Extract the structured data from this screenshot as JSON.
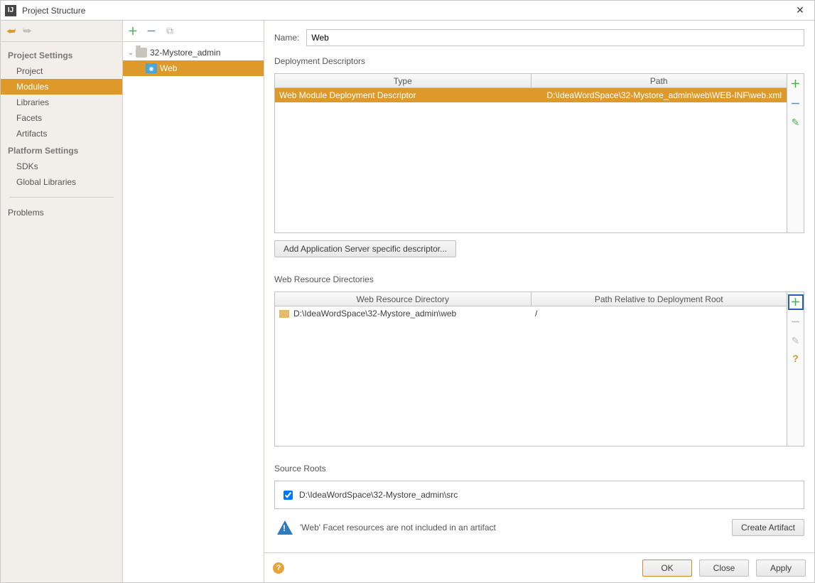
{
  "window": {
    "title": "Project Structure"
  },
  "sidebar": {
    "sections": [
      {
        "header": "Project Settings",
        "items": [
          "Project",
          "Modules",
          "Libraries",
          "Facets",
          "Artifacts"
        ],
        "selected": 1
      },
      {
        "header": "Platform Settings",
        "items": [
          "SDKs",
          "Global Libraries"
        ]
      }
    ],
    "problems": "Problems"
  },
  "tree": {
    "root": "32-Mystore_admin",
    "child": "Web"
  },
  "form": {
    "nameLabel": "Name:",
    "nameValue": "Web",
    "deployment": {
      "label": "Deployment Descriptors",
      "headers": [
        "Type",
        "Path"
      ],
      "row": {
        "type": "Web Module Deployment Descriptor",
        "path": "D:\\IdeaWordSpace\\32-Mystore_admin\\web\\WEB-INF\\web.xml"
      },
      "addBtn": "Add Application Server specific descriptor..."
    },
    "webres": {
      "label": "Web Resource Directories",
      "headers": [
        "Web Resource Directory",
        "Path Relative to Deployment Root"
      ],
      "row": {
        "dir": "D:\\IdeaWordSpace\\32-Mystore_admin\\web",
        "path": "/"
      }
    },
    "source": {
      "label": "Source Roots",
      "path": "D:\\IdeaWordSpace\\32-Mystore_admin\\src"
    },
    "warning": "'Web' Facet resources are not included in an artifact",
    "createArtifact": "Create Artifact"
  },
  "footer": {
    "ok": "OK",
    "close": "Close",
    "apply": "Apply"
  }
}
